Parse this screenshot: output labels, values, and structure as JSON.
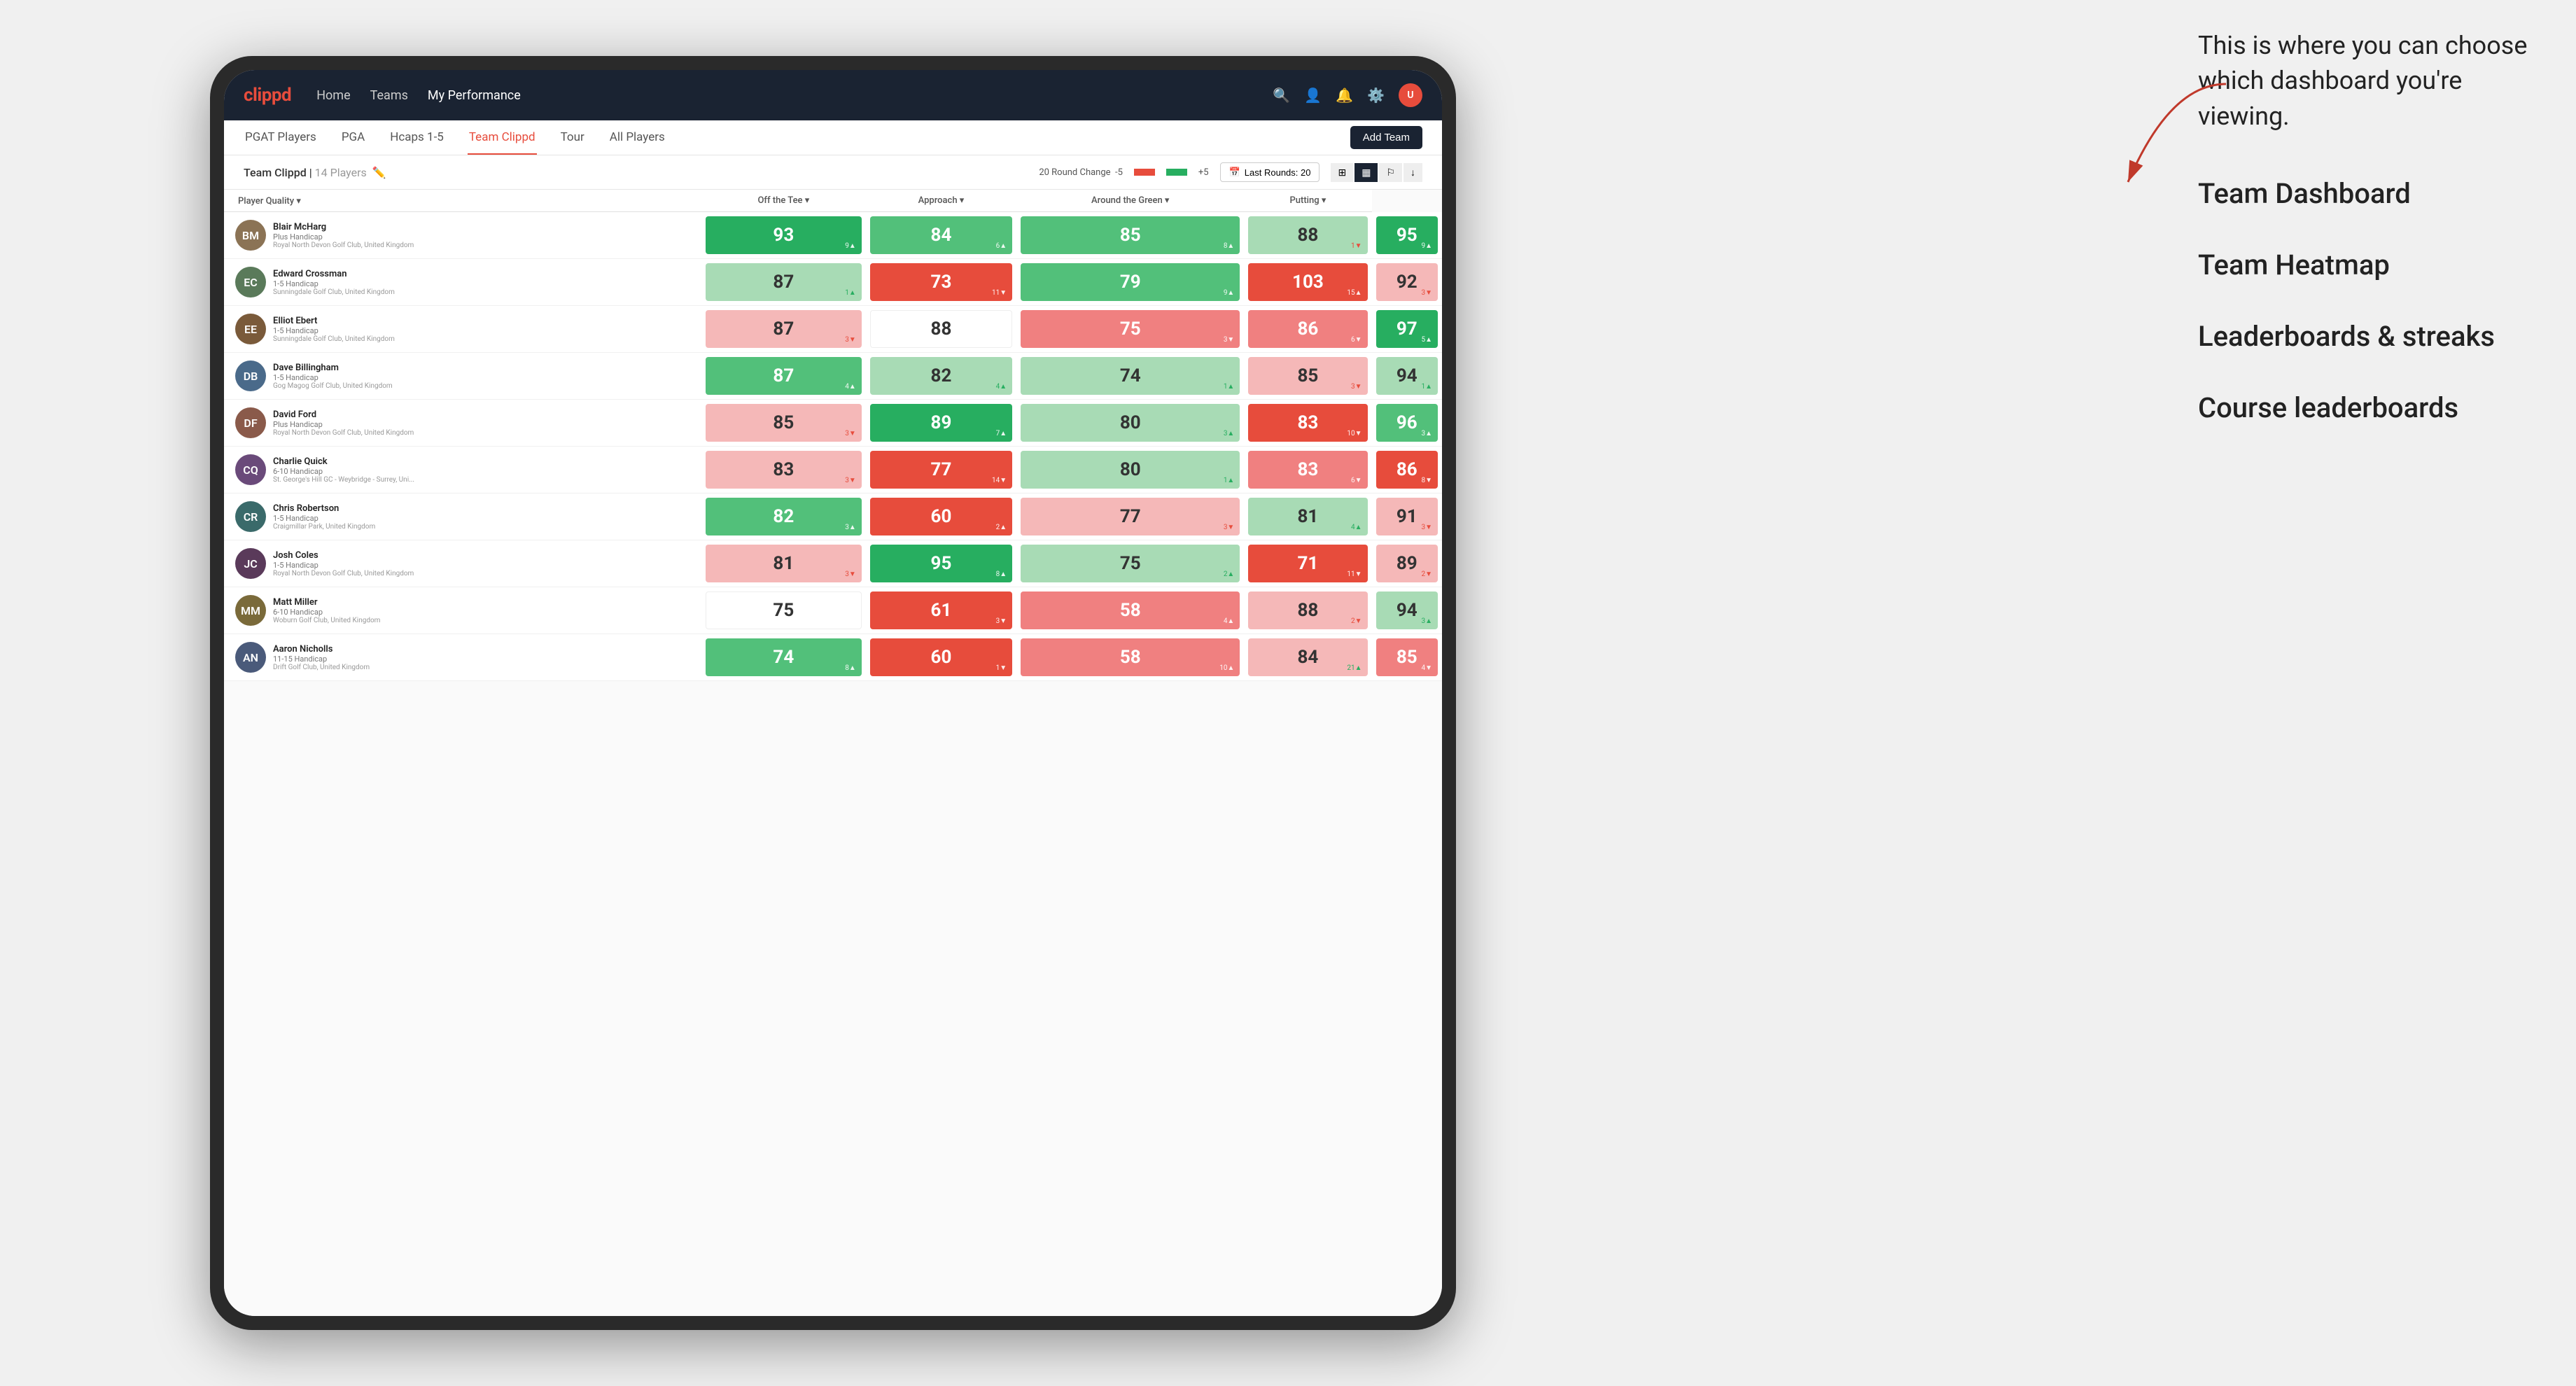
{
  "annotation": {
    "intro": "This is where you can choose which dashboard you're viewing.",
    "menu_items": [
      "Team Dashboard",
      "Team Heatmap",
      "Leaderboards & streaks",
      "Course leaderboards"
    ]
  },
  "nav": {
    "logo": "clippd",
    "links": [
      "Home",
      "Teams",
      "My Performance"
    ],
    "active_link": "My Performance"
  },
  "sub_tabs": {
    "tabs": [
      "PGAT Players",
      "PGA",
      "Hcaps 1-5",
      "Team Clippd",
      "Tour",
      "All Players"
    ],
    "active_tab": "Team Clippd",
    "add_team_label": "Add Team"
  },
  "team_header": {
    "team_name": "Team Clippd",
    "player_count": "14 Players",
    "round_change_label": "20 Round Change",
    "round_change_min": "-5",
    "round_change_max": "+5",
    "last_rounds_label": "Last Rounds:",
    "last_rounds_value": "20"
  },
  "table": {
    "columns": [
      "Player Quality ▾",
      "Off the Tee ▾",
      "Approach ▾",
      "Around the Green ▾",
      "Putting ▾"
    ],
    "rows": [
      {
        "name": "Blair McHarg",
        "handicap": "Plus Handicap",
        "club": "Royal North Devon Golf Club, United Kingdom",
        "avatar_color": "#8B7355",
        "initials": "BM",
        "metrics": [
          {
            "value": "93",
            "change": "9▲",
            "type": "green-dark"
          },
          {
            "value": "84",
            "change": "6▲",
            "type": "green-mid"
          },
          {
            "value": "85",
            "change": "8▲",
            "type": "green-mid"
          },
          {
            "value": "88",
            "change": "1▼",
            "type": "green-light"
          },
          {
            "value": "95",
            "change": "9▲",
            "type": "green-dark"
          }
        ]
      },
      {
        "name": "Edward Crossman",
        "handicap": "1-5 Handicap",
        "club": "Sunningdale Golf Club, United Kingdom",
        "avatar_color": "#5a7a5a",
        "initials": "EC",
        "metrics": [
          {
            "value": "87",
            "change": "1▲",
            "type": "green-light"
          },
          {
            "value": "73",
            "change": "11▼",
            "type": "red-dark"
          },
          {
            "value": "79",
            "change": "9▲",
            "type": "green-mid"
          },
          {
            "value": "103",
            "change": "15▲",
            "type": "red-dark"
          },
          {
            "value": "92",
            "change": "3▼",
            "type": "red-light"
          }
        ]
      },
      {
        "name": "Elliot Ebert",
        "handicap": "1-5 Handicap",
        "club": "Sunningdale Golf Club, United Kingdom",
        "avatar_color": "#7a5a3a",
        "initials": "EE",
        "metrics": [
          {
            "value": "87",
            "change": "3▼",
            "type": "red-light"
          },
          {
            "value": "88",
            "change": "",
            "type": "neutral"
          },
          {
            "value": "75",
            "change": "3▼",
            "type": "red-mid"
          },
          {
            "value": "86",
            "change": "6▼",
            "type": "red-mid"
          },
          {
            "value": "97",
            "change": "5▲",
            "type": "green-dark"
          }
        ]
      },
      {
        "name": "Dave Billingham",
        "handicap": "1-5 Handicap",
        "club": "Gog Magog Golf Club, United Kingdom",
        "avatar_color": "#4a6a8a",
        "initials": "DB",
        "metrics": [
          {
            "value": "87",
            "change": "4▲",
            "type": "green-mid"
          },
          {
            "value": "82",
            "change": "4▲",
            "type": "green-light"
          },
          {
            "value": "74",
            "change": "1▲",
            "type": "green-light"
          },
          {
            "value": "85",
            "change": "3▼",
            "type": "red-light"
          },
          {
            "value": "94",
            "change": "1▲",
            "type": "green-light"
          }
        ]
      },
      {
        "name": "David Ford",
        "handicap": "Plus Handicap",
        "club": "Royal North Devon Golf Club, United Kingdom",
        "avatar_color": "#8a5a4a",
        "initials": "DF",
        "metrics": [
          {
            "value": "85",
            "change": "3▼",
            "type": "red-light"
          },
          {
            "value": "89",
            "change": "7▲",
            "type": "green-dark"
          },
          {
            "value": "80",
            "change": "3▲",
            "type": "green-light"
          },
          {
            "value": "83",
            "change": "10▼",
            "type": "red-dark"
          },
          {
            "value": "96",
            "change": "3▲",
            "type": "green-mid"
          }
        ]
      },
      {
        "name": "Charlie Quick",
        "handicap": "6-10 Handicap",
        "club": "St. George's Hill GC - Weybridge - Surrey, Uni...",
        "avatar_color": "#6a4a7a",
        "initials": "CQ",
        "metrics": [
          {
            "value": "83",
            "change": "3▼",
            "type": "red-light"
          },
          {
            "value": "77",
            "change": "14▼",
            "type": "red-dark"
          },
          {
            "value": "80",
            "change": "1▲",
            "type": "green-light"
          },
          {
            "value": "83",
            "change": "6▼",
            "type": "red-mid"
          },
          {
            "value": "86",
            "change": "8▼",
            "type": "red-dark"
          }
        ]
      },
      {
        "name": "Chris Robertson",
        "handicap": "1-5 Handicap",
        "club": "Craigmillar Park, United Kingdom",
        "avatar_color": "#3a6a6a",
        "initials": "CR",
        "metrics": [
          {
            "value": "82",
            "change": "3▲",
            "type": "green-mid"
          },
          {
            "value": "60",
            "change": "2▲",
            "type": "red-dark"
          },
          {
            "value": "77",
            "change": "3▼",
            "type": "red-light"
          },
          {
            "value": "81",
            "change": "4▲",
            "type": "green-light"
          },
          {
            "value": "91",
            "change": "3▼",
            "type": "red-light"
          }
        ]
      },
      {
        "name": "Josh Coles",
        "handicap": "1-5 Handicap",
        "club": "Royal North Devon Golf Club, United Kingdom",
        "avatar_color": "#5a3a5a",
        "initials": "JC",
        "metrics": [
          {
            "value": "81",
            "change": "3▼",
            "type": "red-light"
          },
          {
            "value": "95",
            "change": "8▲",
            "type": "green-dark"
          },
          {
            "value": "75",
            "change": "2▲",
            "type": "green-light"
          },
          {
            "value": "71",
            "change": "11▼",
            "type": "red-dark"
          },
          {
            "value": "89",
            "change": "2▼",
            "type": "red-light"
          }
        ]
      },
      {
        "name": "Matt Miller",
        "handicap": "6-10 Handicap",
        "club": "Woburn Golf Club, United Kingdom",
        "avatar_color": "#7a6a3a",
        "initials": "MM",
        "metrics": [
          {
            "value": "75",
            "change": "",
            "type": "neutral"
          },
          {
            "value": "61",
            "change": "3▼",
            "type": "red-dark"
          },
          {
            "value": "58",
            "change": "4▲",
            "type": "red-mid"
          },
          {
            "value": "88",
            "change": "2▼",
            "type": "red-light"
          },
          {
            "value": "94",
            "change": "3▲",
            "type": "green-light"
          }
        ]
      },
      {
        "name": "Aaron Nicholls",
        "handicap": "11-15 Handicap",
        "club": "Drift Golf Club, United Kingdom",
        "avatar_color": "#4a5a7a",
        "initials": "AN",
        "metrics": [
          {
            "value": "74",
            "change": "8▲",
            "type": "green-mid"
          },
          {
            "value": "60",
            "change": "1▼",
            "type": "red-dark"
          },
          {
            "value": "58",
            "change": "10▲",
            "type": "red-mid"
          },
          {
            "value": "84",
            "change": "21▲",
            "type": "red-light"
          },
          {
            "value": "85",
            "change": "4▼",
            "type": "red-mid"
          }
        ]
      }
    ]
  }
}
